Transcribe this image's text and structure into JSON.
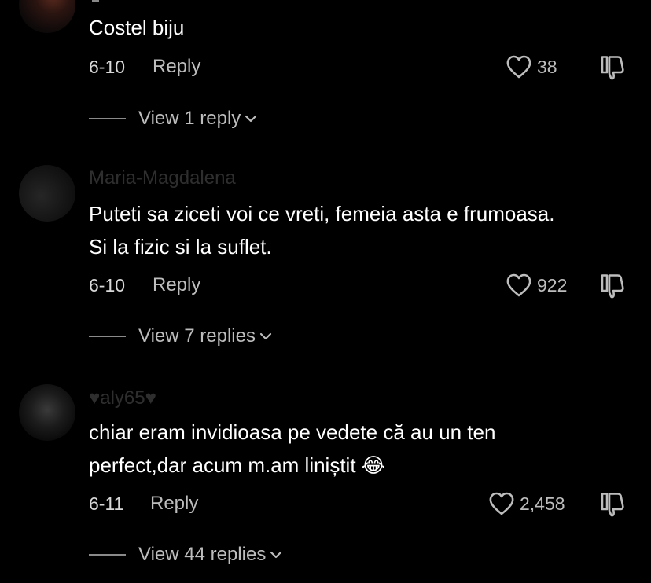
{
  "comments": [
    {
      "username": "",
      "text": "Costel biju",
      "date": "6-10",
      "reply_label": "Reply",
      "likes": "38",
      "view_replies": "View 1 reply"
    },
    {
      "username": "Maria-Magdalena",
      "text": "Puteti sa ziceti voi ce vreti, femeia asta e frumoasa. Si la fizic si la suflet.",
      "date": "6-10",
      "reply_label": "Reply",
      "likes": "922",
      "view_replies": "View 7 replies"
    },
    {
      "username": "♥aly65♥",
      "text": "chiar eram invidioasa pe vedete că au un ten perfect,dar acum m.am liniștit 😂",
      "date": "6-11",
      "reply_label": "Reply",
      "likes": "2,458",
      "view_replies": "View 44 replies"
    }
  ],
  "icons": {
    "like": "heart-outline-icon",
    "dislike": "thumbs-down-icon",
    "expand": "chevron-down-icon"
  },
  "colors": {
    "background": "#000000",
    "text": "#ffffff",
    "secondary": "#bdbdbd"
  }
}
